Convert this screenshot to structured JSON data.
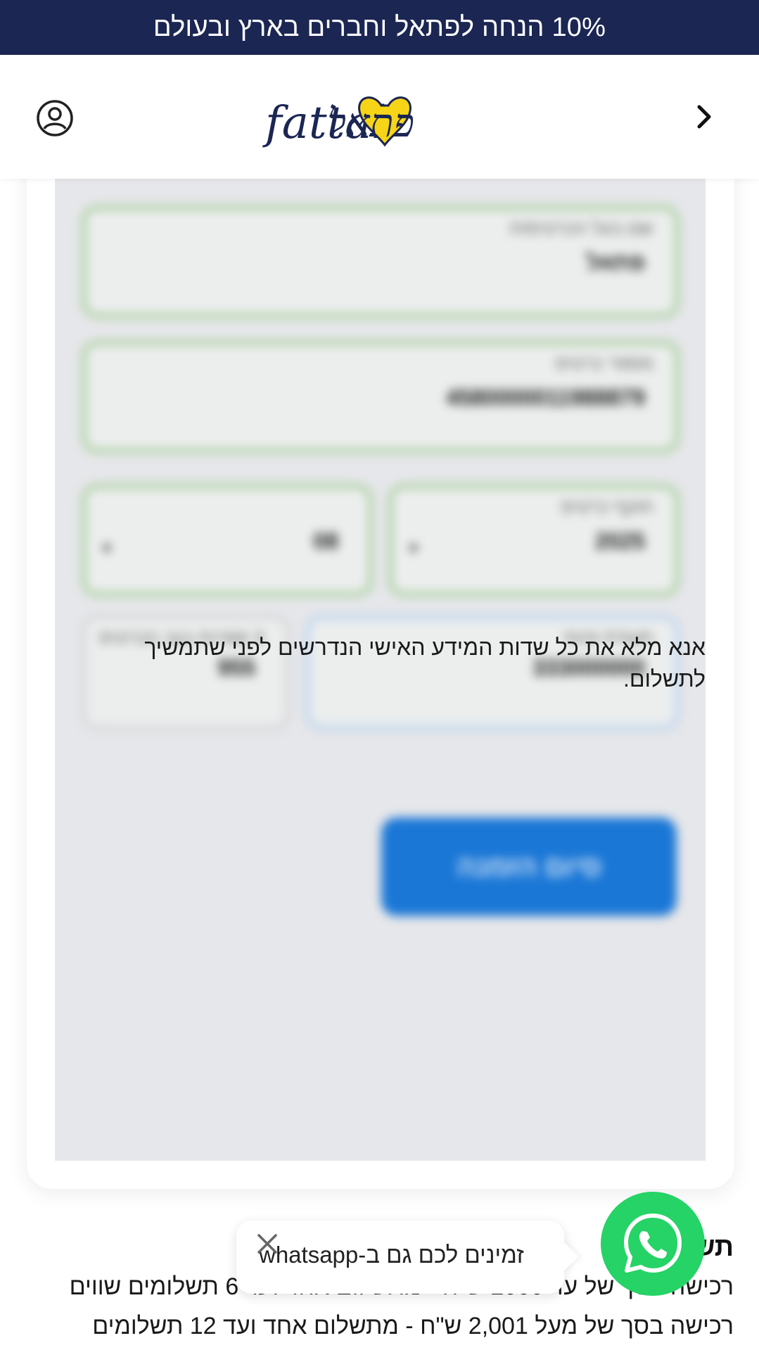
{
  "promo_bar": {
    "text": "10% הנחה לפתאל וחברים בארץ ובעולם"
  },
  "header": {
    "logo_latin": "fattal",
    "logo_hebrew": "פתאל",
    "back_icon": "chevron-right-icon",
    "account_icon": "user-icon"
  },
  "payment_form": {
    "card_holder": {
      "label": "שם בעל הכרטיס/ת",
      "value": "פתאל"
    },
    "card_number": {
      "label": "מספר כרטיס",
      "value": "4580000011988879"
    },
    "expiry_year": {
      "label": "תוקף כרטיס",
      "value": "2025"
    },
    "expiry_month": {
      "value": "08"
    },
    "id_number": {
      "label": "תעודת זהות",
      "value": "333000000"
    },
    "cvv": {
      "label": "3 ספרות בגב הכרטיס",
      "value": "955"
    },
    "submit_label": "סיום הזמנה",
    "notice": "אנא מלא את כל שדות המידע האישי הנדרשים לפני שתמשיך לתשלום."
  },
  "whatsapp": {
    "bubble_text": "זמינים לכם גם ב-whatsapp",
    "icon": "whatsapp-icon",
    "close_icon": "close-icon",
    "accent": "#25d366"
  },
  "installments": {
    "title": "תשלומים",
    "lines": [
      "רכישה בסך של עד 2000 ש\"ח - מתשלום אחד ועד 6 תשלומים שווים",
      "רכישה בסך של מעל 2,001 ש\"ח  - מתשלום אחד ועד 12 תשלומים"
    ]
  },
  "colors": {
    "promo_bg": "#1b2653",
    "brand_yellow": "#f7d417",
    "brand_navy": "#1b2653",
    "button_blue": "#1a77d6"
  }
}
